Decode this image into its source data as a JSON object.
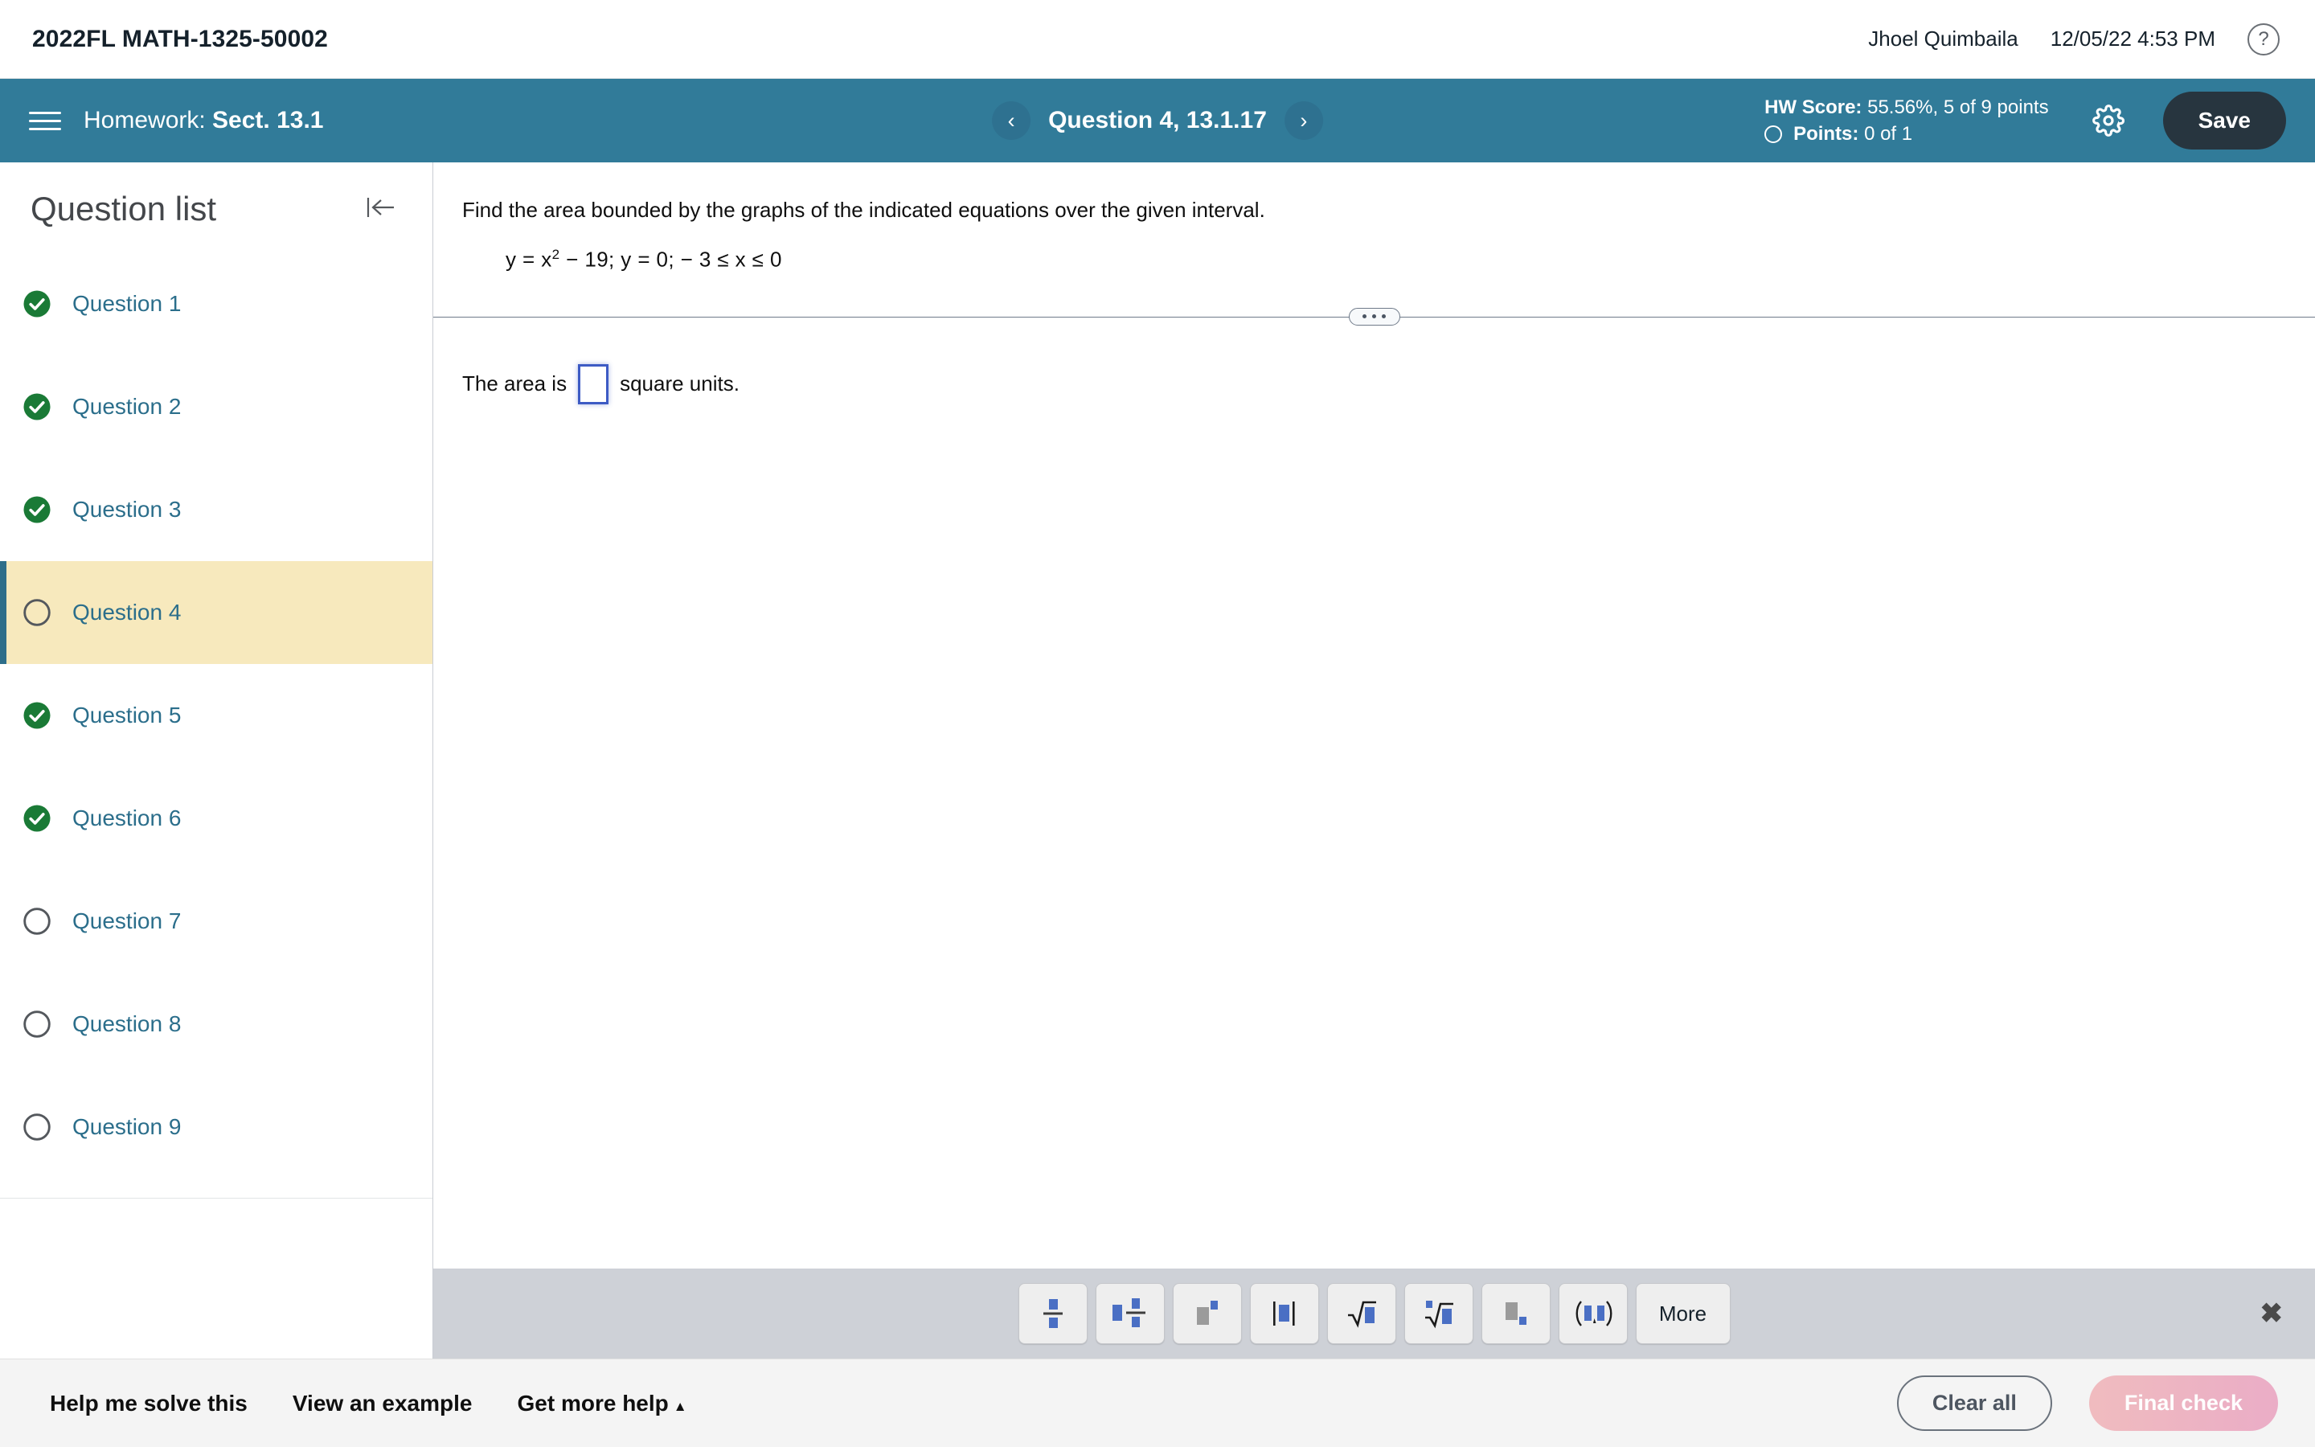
{
  "topbar": {
    "course_code": "2022FL MATH-1325-50002",
    "user_name": "Jhoel Quimbaila",
    "timestamp": "12/05/22 4:53 PM",
    "help_glyph": "?"
  },
  "navbar": {
    "assignment_prefix": "Homework:",
    "assignment_name": "Sect. 13.1",
    "prev_glyph": "‹",
    "next_glyph": "›",
    "question_label": "Question 4, 13.1.17",
    "hw_score_label": "HW Score:",
    "hw_score_value": "55.56%, 5 of 9 points",
    "points_label": "Points:",
    "points_value": "0 of 1",
    "save_label": "Save",
    "accent_color": "#317b99",
    "save_bg_color": "#27353f"
  },
  "sidebar": {
    "title": "Question list",
    "items": [
      {
        "label": "Question 1",
        "status": "complete"
      },
      {
        "label": "Question 2",
        "status": "complete"
      },
      {
        "label": "Question 3",
        "status": "complete"
      },
      {
        "label": "Question 4",
        "status": "current"
      },
      {
        "label": "Question 5",
        "status": "complete"
      },
      {
        "label": "Question 6",
        "status": "complete"
      },
      {
        "label": "Question 7",
        "status": "incomplete"
      },
      {
        "label": "Question 8",
        "status": "incomplete"
      },
      {
        "label": "Question 9",
        "status": "incomplete"
      }
    ],
    "complete_color": "#1a7a36",
    "link_color": "#2b6e8b",
    "active_bg_color": "#f7e9bd"
  },
  "problem": {
    "stem": "Find the area bounded by the graphs of the indicated equations over the given interval.",
    "equation_prefix": "y = x",
    "equation_exponent": "2",
    "equation_suffix": "− 19;  y = 0;  − 3 ≤ x ≤ 0",
    "answer_prefix": "The area is",
    "answer_value": "",
    "answer_placeholder": "",
    "answer_suffix": "square units."
  },
  "math_toolbar": {
    "keys": [
      {
        "name": "fraction",
        "glyph": "fraction"
      },
      {
        "name": "mixed-number",
        "glyph": "mixed-number"
      },
      {
        "name": "exponent",
        "glyph": "exponent"
      },
      {
        "name": "absolute-value",
        "glyph": "absolute-value"
      },
      {
        "name": "square-root",
        "glyph": "square-root"
      },
      {
        "name": "nth-root",
        "glyph": "nth-root"
      },
      {
        "name": "subscript",
        "glyph": "subscript"
      },
      {
        "name": "interval",
        "glyph": "interval"
      }
    ],
    "more_label": "More",
    "close_glyph": "✖"
  },
  "bottombar": {
    "help_me_solve": "Help me solve this",
    "view_example": "View an example",
    "get_more_help": "Get more help",
    "get_more_help_caret": "▲",
    "clear_all": "Clear all",
    "final_check": "Final check"
  }
}
